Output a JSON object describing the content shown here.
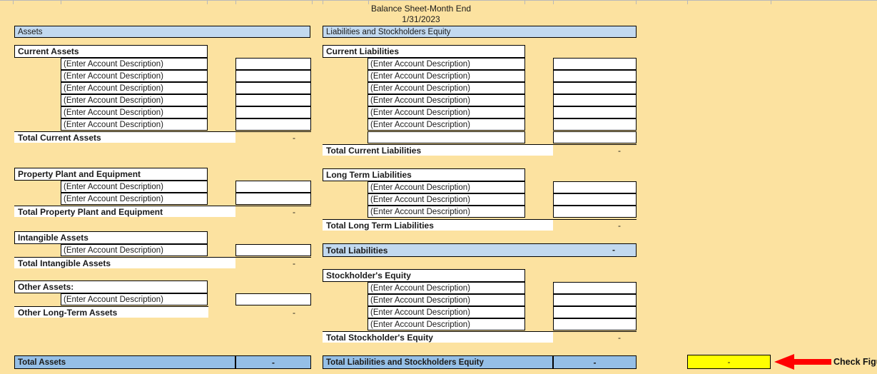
{
  "title": {
    "line1": "Balance Sheet-Month End",
    "line2": "1/31/2023"
  },
  "colors": {
    "background": "#fce2a0",
    "header_blue": "#c2d9ef",
    "total_blue": "#95bfe6",
    "check_yellow": "#ffff00",
    "arrow_red": "#ff0000"
  },
  "placeholder": "(Enter Account Description)",
  "dash": "-",
  "left_column": {
    "header": "Assets",
    "sections": [
      {
        "heading": "Current Assets",
        "rows": [
          "(Enter Account Description)",
          "(Enter Account Description)",
          "(Enter Account Description)",
          "(Enter Account Description)",
          "(Enter Account Description)",
          "(Enter Account Description)"
        ],
        "total_label": "Total Current Assets",
        "total_value": "-"
      },
      {
        "heading": "Property Plant and Equipment",
        "rows": [
          "(Enter Account Description)",
          "(Enter Account Description)"
        ],
        "total_label": "Total Property Plant and Equipment",
        "total_value": "-"
      },
      {
        "heading": "Intangible Assets",
        "rows": [
          "(Enter Account Description)"
        ],
        "total_label": "Total Intangible Assets",
        "total_value": "-"
      },
      {
        "heading": "Other Assets:",
        "rows": [
          "(Enter Account Description)"
        ],
        "total_label": "Other Long-Term Assets",
        "total_value": "-"
      }
    ],
    "grand_total_label": "Total Assets",
    "grand_total_value": "-"
  },
  "right_column": {
    "header": "Liabilities and Stockholders Equity",
    "sections": [
      {
        "heading": "Current Liabilities",
        "rows": [
          "(Enter Account Description)",
          "(Enter Account Description)",
          "(Enter Account Description)",
          "(Enter Account Description)",
          "(Enter Account Description)",
          "(Enter Account Description)"
        ],
        "total_label": "Total Current Liabilities",
        "total_value": "-"
      },
      {
        "heading": "Long Term Liabilities",
        "rows": [
          "(Enter Account Description)",
          "(Enter Account Description)",
          "(Enter Account Description)"
        ],
        "total_label": "Total Long Term Liabilities",
        "total_value": "-"
      }
    ],
    "total_liabilities_label": "Total Liabilities",
    "total_liabilities_value": "-",
    "equity": {
      "heading": "Stockholder's Equity",
      "rows": [
        "(Enter Account Description)",
        "(Enter Account Description)",
        "(Enter Account Description)",
        "(Enter Account Description)"
      ],
      "total_label": "Total Stockholder's Equity",
      "total_value": "-"
    },
    "grand_total_label": "Total Liabilities and Stockholders Equity",
    "grand_total_value": "-"
  },
  "check_figure": {
    "value": "-",
    "label": "Check Figure"
  }
}
